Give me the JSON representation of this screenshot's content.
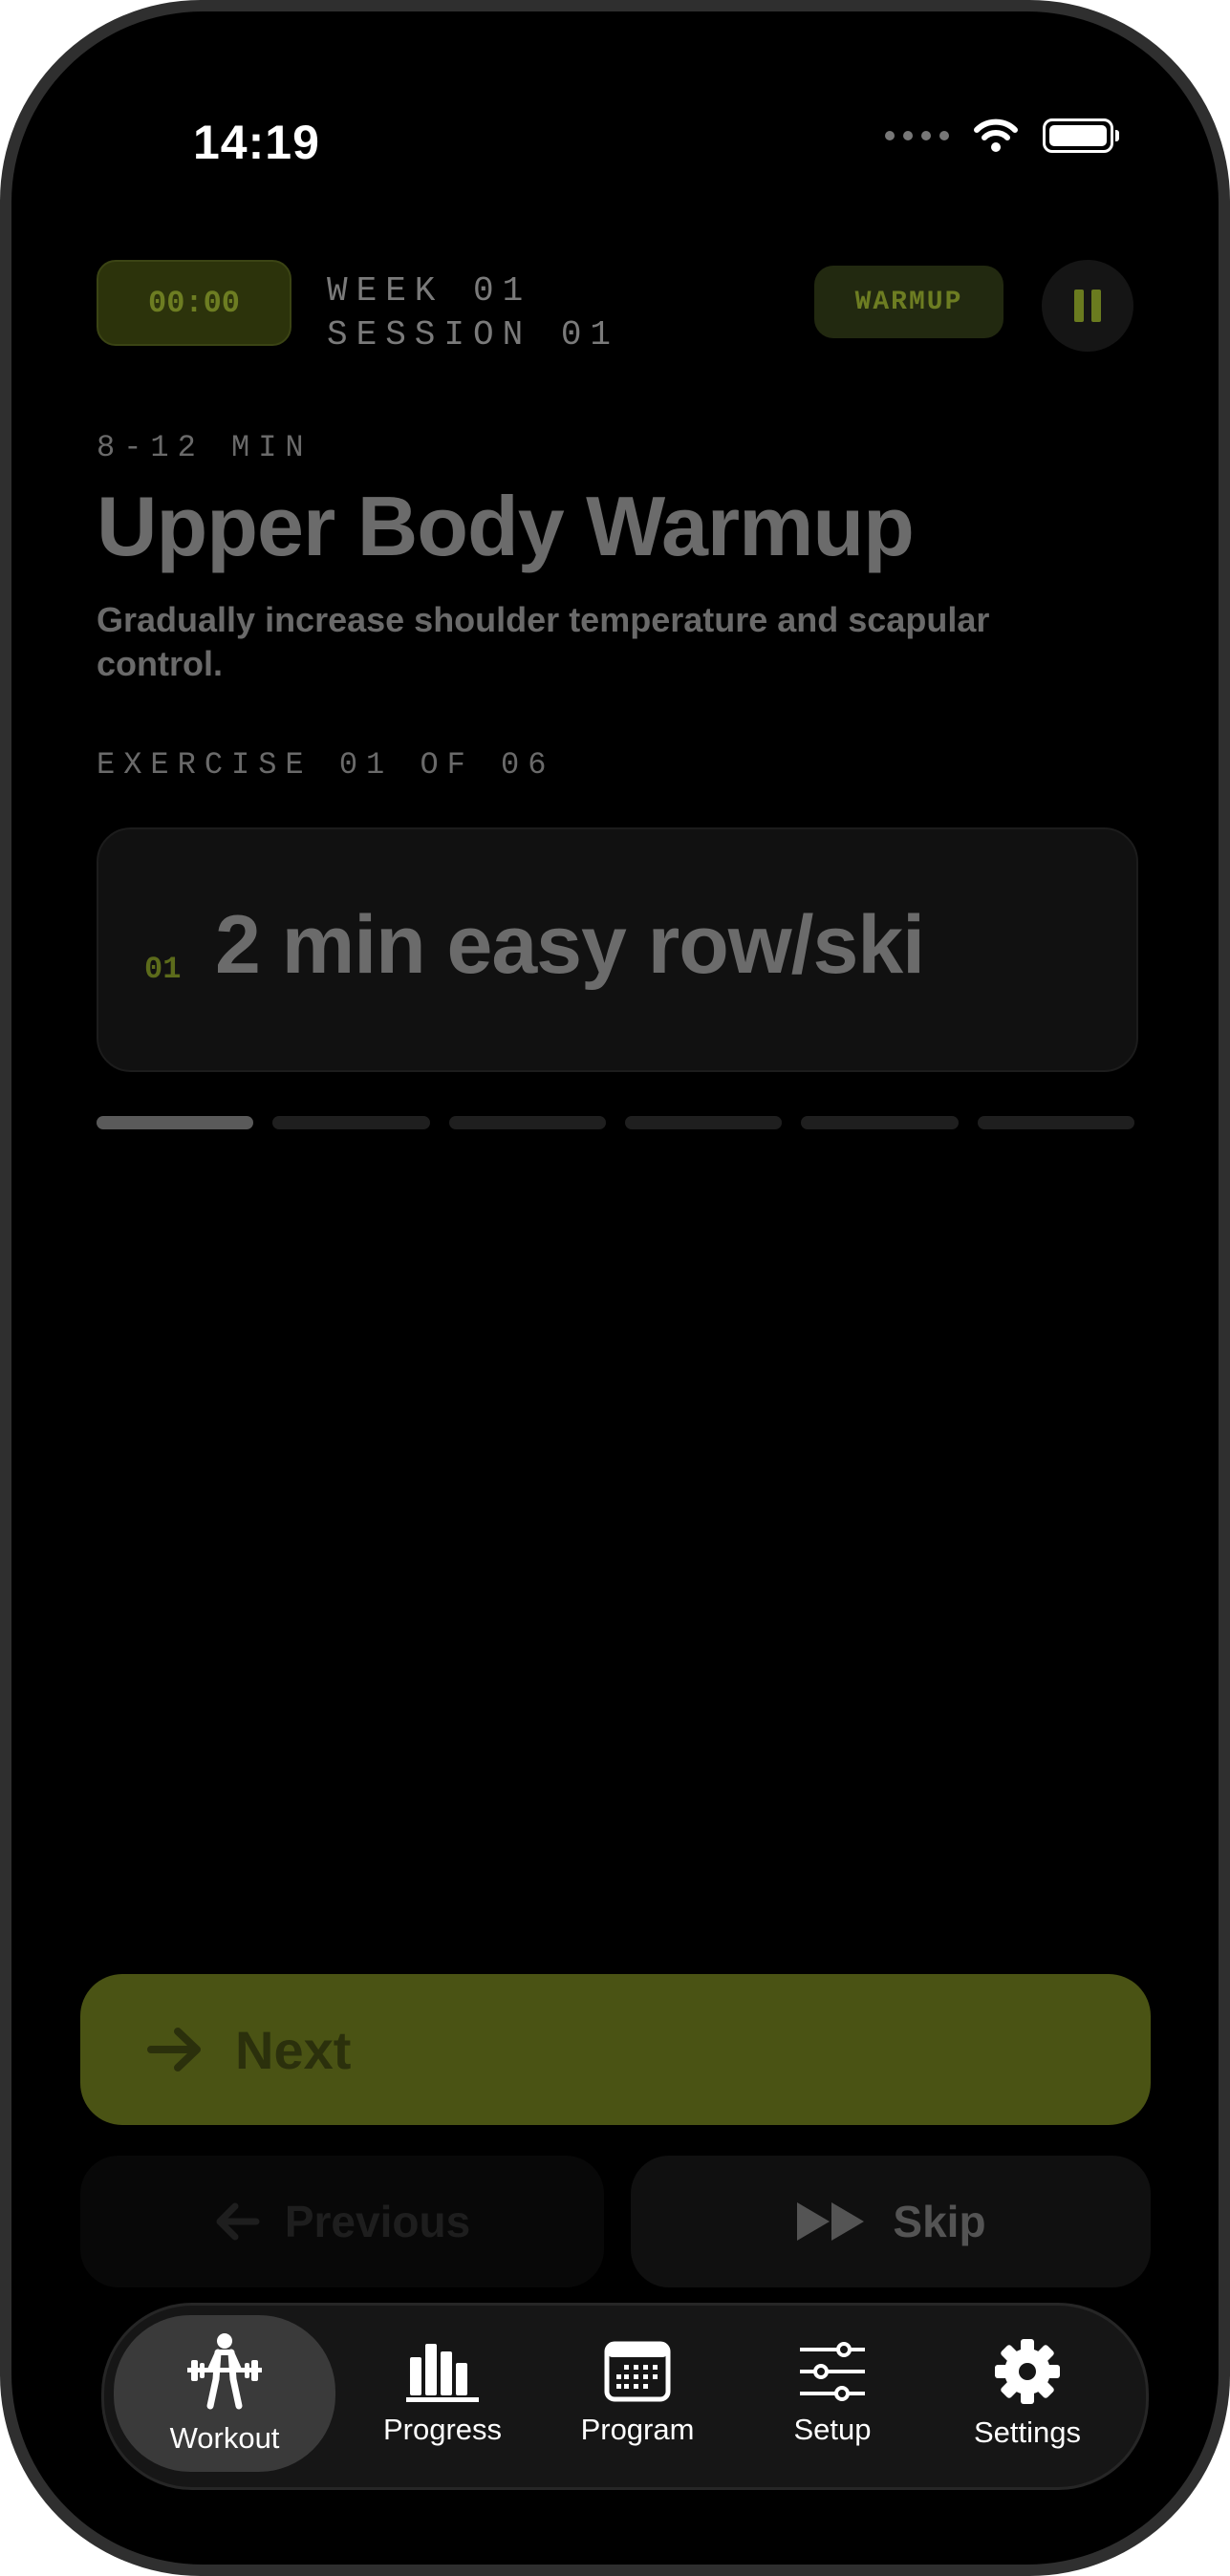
{
  "status": {
    "time": "14:19"
  },
  "header": {
    "timer": "00:00",
    "week": "WEEK 01",
    "session": "SESSION 01",
    "badge": "WARMUP"
  },
  "block": {
    "duration": "8-12 MIN",
    "title": "Upper Body Warmup",
    "description": "Gradually increase shoulder temperature and scapular control.",
    "exercise_count": "EXERCISE 01 OF 06"
  },
  "exercise": {
    "number": "01",
    "title": "2 min easy row/ski"
  },
  "progress": {
    "total": 6,
    "current": 1
  },
  "actions": {
    "next_label": "Next",
    "previous_label": "Previous",
    "skip_label": "Skip"
  },
  "tabs": [
    {
      "label": "Workout",
      "icon": "weightlifter-icon",
      "active": true
    },
    {
      "label": "Progress",
      "icon": "bar-chart-icon",
      "active": false
    },
    {
      "label": "Program",
      "icon": "calendar-icon",
      "active": false
    },
    {
      "label": "Setup",
      "icon": "sliders-icon",
      "active": false
    },
    {
      "label": "Settings",
      "icon": "gear-icon",
      "active": false
    }
  ],
  "colors": {
    "accent": "#4a5314",
    "accent_text": "#6d7d22",
    "background": "#000000"
  }
}
